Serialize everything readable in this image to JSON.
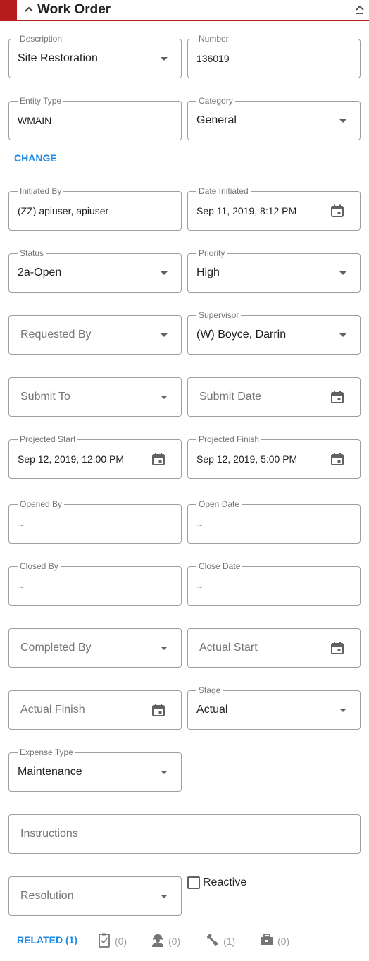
{
  "header": {
    "title": "Work Order"
  },
  "fields": {
    "description": {
      "label": "Description",
      "value": "Site Restoration"
    },
    "number": {
      "label": "Number",
      "value": "136019"
    },
    "entity_type": {
      "label": "Entity Type",
      "value": "WMAIN"
    },
    "category": {
      "label": "Category",
      "value": "General"
    },
    "initiated_by": {
      "label": "Initiated By",
      "value": "(ZZ) apiuser, apiuser"
    },
    "date_initiated": {
      "label": "Date Initiated",
      "value": "Sep 11, 2019, 8:12 PM"
    },
    "status": {
      "label": "Status",
      "value": "2a-Open"
    },
    "priority": {
      "label": "Priority",
      "value": "High"
    },
    "requested_by": {
      "placeholder": "Requested By"
    },
    "supervisor": {
      "label": "Supervisor",
      "value": "(W) Boyce, Darrin"
    },
    "submit_to": {
      "placeholder": "Submit To"
    },
    "submit_date": {
      "placeholder": "Submit Date"
    },
    "projected_start": {
      "label": "Projected Start",
      "value": "Sep 12, 2019, 12:00 PM"
    },
    "projected_finish": {
      "label": "Projected Finish",
      "value": "Sep 12, 2019, 5:00 PM"
    },
    "opened_by": {
      "label": "Opened By",
      "value": "~"
    },
    "open_date": {
      "label": "Open Date",
      "value": "~"
    },
    "closed_by": {
      "label": "Closed By",
      "value": "~"
    },
    "close_date": {
      "label": "Close Date",
      "value": "~"
    },
    "completed_by": {
      "placeholder": "Completed By"
    },
    "actual_start": {
      "placeholder": "Actual Start"
    },
    "actual_finish": {
      "placeholder": "Actual Finish"
    },
    "stage": {
      "label": "Stage",
      "value": "Actual"
    },
    "expense_type": {
      "label": "Expense Type",
      "value": "Maintenance"
    },
    "instructions": {
      "placeholder": "Instructions"
    },
    "resolution": {
      "placeholder": "Resolution"
    }
  },
  "change_label": "CHANGE",
  "reactive": {
    "label": "Reactive",
    "checked": false
  },
  "footer": {
    "related_label": "RELATED (1)",
    "tasks_count": "(0)",
    "labor_count": "(0)",
    "equipment_count": "(1)",
    "materials_count": "(0)"
  },
  "icons": {
    "caret": "chevron-up-icon",
    "collapse": "collapse-icon",
    "dropdown": "arrow-drop-down-icon",
    "calendar": "calendar-icon",
    "tasks": "clipboard-icon",
    "labor": "worker-icon",
    "equipment": "wrench-icon",
    "materials": "toolbox-icon"
  },
  "colors": {
    "accent": "#b71c1c",
    "link": "#1e88e5",
    "border": "#9e9e9e"
  }
}
